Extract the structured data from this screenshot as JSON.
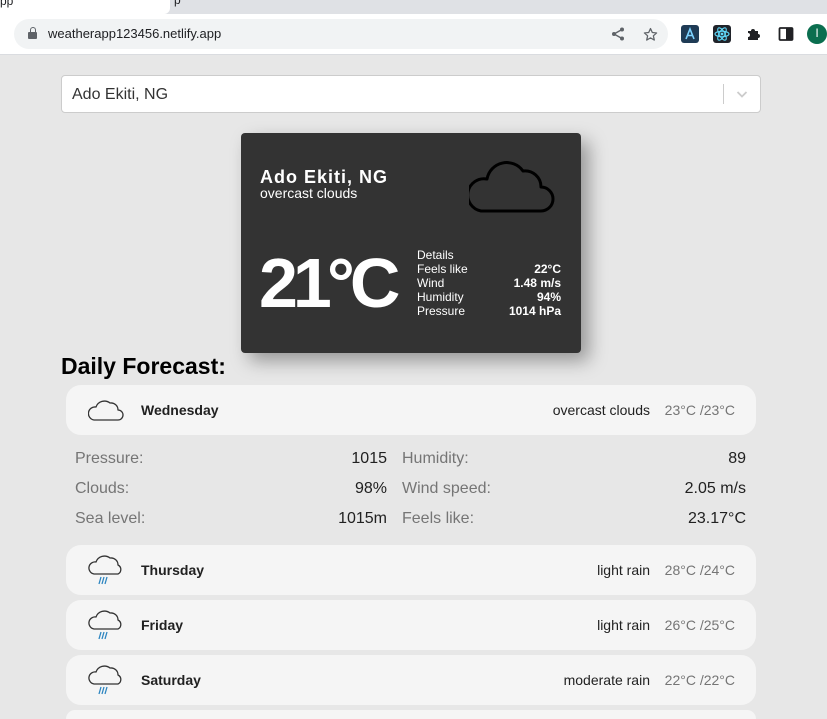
{
  "browser": {
    "active_tab_title": "pp",
    "next_tab_title": "p",
    "url": "weatherapp123456.netlify.app",
    "profile_initial": "I"
  },
  "search": {
    "selected_value": "Ado Ekiti, NG"
  },
  "current": {
    "city": "Ado Ekiti, NG",
    "description": "overcast clouds",
    "temperature": "21°C",
    "icon": "cloud-icon",
    "details_heading": "Details",
    "details": [
      {
        "label": "Feels like",
        "value": "22°C"
      },
      {
        "label": "Wind",
        "value": "1.48 m/s"
      },
      {
        "label": "Humidity",
        "value": "94%"
      },
      {
        "label": "Pressure",
        "value": "1014 hPa"
      }
    ]
  },
  "forecast": {
    "title": "Daily Forecast:",
    "days": [
      {
        "day": "Wednesday",
        "description": "overcast clouds",
        "minmax": "23°C /23°C",
        "icon": "cloud-icon"
      },
      {
        "day": "Thursday",
        "description": "light rain",
        "minmax": "28°C /24°C",
        "icon": "rain-icon"
      },
      {
        "day": "Friday",
        "description": "light rain",
        "minmax": "26°C /25°C",
        "icon": "rain-icon"
      },
      {
        "day": "Saturday",
        "description": "moderate rain",
        "minmax": "22°C /22°C",
        "icon": "rain-icon"
      }
    ],
    "expanded": [
      {
        "label1": "Pressure:",
        "value1": "1015",
        "label2": "Humidity:",
        "value2": "89"
      },
      {
        "label1": "Clouds:",
        "value1": "98%",
        "label2": "Wind speed:",
        "value2": "2.05 m/s"
      },
      {
        "label1": "Sea level:",
        "value1": "1015m",
        "label2": "Feels like:",
        "value2": "23.17°C"
      }
    ]
  },
  "colors": {
    "page_bg": "#e7e7e7",
    "card_bg": "#333333",
    "day_bg": "#f5f5f5",
    "rain_accent": "#2e86c1"
  }
}
